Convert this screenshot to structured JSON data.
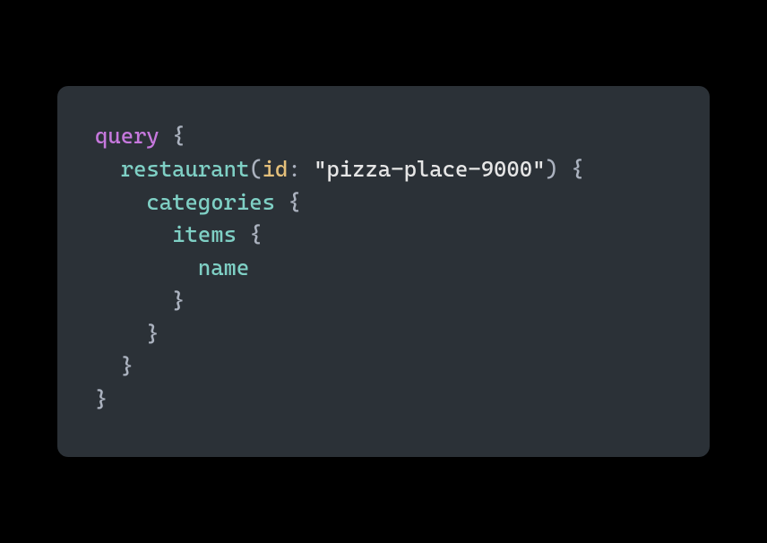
{
  "code": {
    "line1_keyword": "query",
    "line1_brace": " {",
    "line2_indent": "  ",
    "line2_field": "restaurant",
    "line2_paren_open": "(",
    "line2_param": "id",
    "line2_colon": ": ",
    "line2_string": "\"pizza-place-9000\"",
    "line2_paren_close": ")",
    "line2_brace": " {",
    "line3_indent": "    ",
    "line3_field": "categories",
    "line3_brace": " {",
    "line4_indent": "      ",
    "line4_field": "items",
    "line4_brace": " {",
    "line5_indent": "        ",
    "line5_field": "name",
    "line6_indent": "      ",
    "line6_brace": "}",
    "line7_indent": "    ",
    "line7_brace": "}",
    "line8_indent": "  ",
    "line8_brace": "}",
    "line9_brace": "}"
  }
}
